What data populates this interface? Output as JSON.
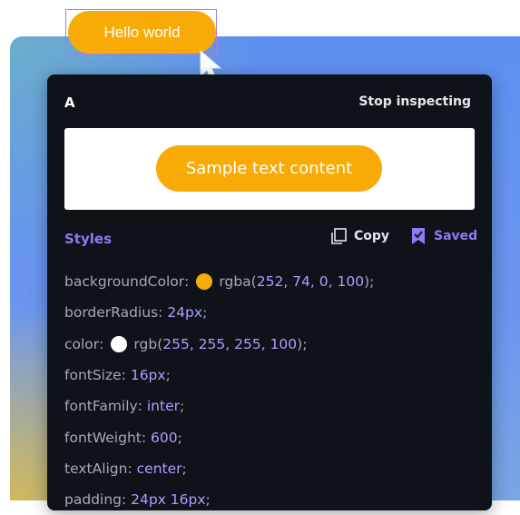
{
  "element_button": {
    "label": "Hello world"
  },
  "inspector": {
    "title": "A",
    "stop_label": "Stop inspecting",
    "preview_label": "Sample text content",
    "styles_heading": "Styles",
    "copy_label": "Copy",
    "saved_label": "Saved"
  },
  "colors": {
    "button_bg": "#f8ab06",
    "accent": "#8b7cf6",
    "panel_bg": "#0e1219"
  },
  "styles": [
    {
      "prop": "backgroundColor",
      "fn": "rgba",
      "args": "252, 74, 0, 100",
      "swatch": "#f8ab06"
    },
    {
      "prop": "borderRadius",
      "value": "24px"
    },
    {
      "prop": "color",
      "fn": "rgb",
      "args": "255, 255, 255, 100",
      "swatch": "#ffffff"
    },
    {
      "prop": "fontSize",
      "value": "16px"
    },
    {
      "prop": "fontFamily",
      "value": "inter"
    },
    {
      "prop": "fontWeight",
      "value": "600"
    },
    {
      "prop": "textAlign",
      "value": "center"
    },
    {
      "prop": "padding",
      "value": "24px 16px"
    }
  ]
}
